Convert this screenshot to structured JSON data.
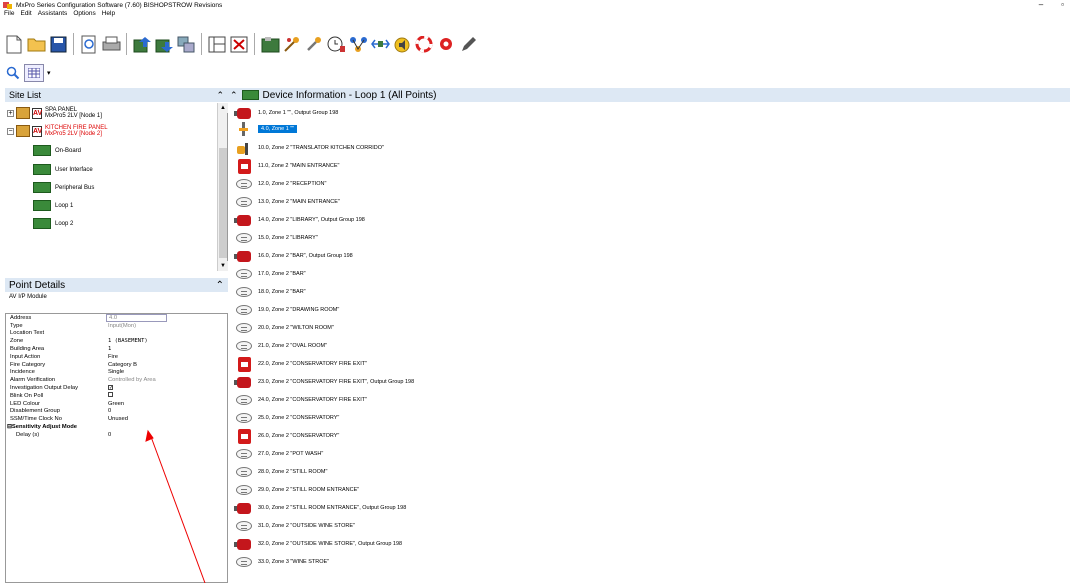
{
  "window": {
    "title": "MxPro Series Configuration Software (7.60)   BISHOPSTROW Revisions",
    "minimize": "–",
    "maximize": "▫"
  },
  "menu": [
    "File",
    "Edit",
    "Assistants",
    "Options",
    "Help"
  ],
  "toolbar_icons": [
    "new-file-icon",
    "open-folder-icon",
    "save-icon",
    "print-preview-icon",
    "print-icon",
    "upload-icon",
    "download-icon",
    "compare-icon",
    "layout-icon",
    "delete-icon",
    "panel-icon",
    "wizard-icon",
    "tools-icon",
    "clock-icon",
    "network-icon",
    "io-icon",
    "sound-icon",
    "help-ring-icon",
    "settings-icon",
    "pen-icon"
  ],
  "site_list": {
    "title": "Site List",
    "nodes": [
      {
        "line1": "SPA PANEL",
        "line2": "MxPro5 2LV [Node 1]",
        "av": "AV",
        "expander": "+",
        "highlight": false
      },
      {
        "line1": "KITCHEN FIRE PANEL",
        "line2": "MxPro5 2LV [Node 2]",
        "av": "AV",
        "expander": "−",
        "highlight": true
      }
    ],
    "children": [
      "On-Board",
      "User Interface",
      "Peripheral Bus",
      "Loop 1",
      "Loop 2"
    ]
  },
  "point_details": {
    "title": "Point Details",
    "subtitle": "AV I/P Module",
    "rows": [
      {
        "label": "Address",
        "value": "4.0",
        "style": "box"
      },
      {
        "label": "Type",
        "value": "Input(Mon)",
        "style": "grey"
      },
      {
        "label": "Location Text",
        "value": "",
        "style": ""
      },
      {
        "label": "Zone",
        "value": "1 (BASEMENT)",
        "style": "mono"
      },
      {
        "label": "Building Area",
        "value": "1",
        "style": "mono"
      },
      {
        "label": "Input Action",
        "value": "Fire",
        "style": ""
      },
      {
        "label": "Fire Category",
        "value": "Category B",
        "style": ""
      },
      {
        "label": "Incidence",
        "value": "Single",
        "style": ""
      },
      {
        "label": "Alarm Verification",
        "value": "Controlled by Area",
        "style": "grey"
      },
      {
        "label": "Investigation Output Delay",
        "value": "✓",
        "style": "check"
      },
      {
        "label": "Blink On Poll",
        "value": "",
        "style": "check"
      },
      {
        "label": "LED Colour",
        "value": "Green",
        "style": ""
      },
      {
        "label": "Disablement Group",
        "value": "0",
        "style": ""
      },
      {
        "label": "SSM/Time Clock No",
        "value": "Unused",
        "style": ""
      }
    ],
    "section": "Sensitivity Adjust Mode",
    "section_rows": [
      {
        "label": "Delay (s)",
        "value": "0"
      }
    ]
  },
  "device_info": {
    "title": "Device Information - Loop 1  (All Points)",
    "devices": [
      {
        "icon": "sounder",
        "text": "1.0, Zone 1 \"\",  Output Group 198",
        "selected": false
      },
      {
        "icon": "io",
        "text": "4.0, Zone 1 \"\"",
        "selected": true
      },
      {
        "icon": "translator",
        "text": "10.0, Zone 2 \"TRANSLATOR KITCHEN CORRIDO\"",
        "selected": false
      },
      {
        "icon": "callpoint",
        "text": "11.0, Zone 2 \"MAIN ENTRANCE\"",
        "selected": false
      },
      {
        "icon": "detector",
        "text": "12.0, Zone 2 \"RECEPTION\"",
        "selected": false
      },
      {
        "icon": "detector",
        "text": "13.0, Zone 2 \"MAIN ENTRANCE\"",
        "selected": false
      },
      {
        "icon": "sounder",
        "text": "14.0, Zone 2 \"LIBRARY\",  Output Group 198",
        "selected": false
      },
      {
        "icon": "detector",
        "text": "15.0, Zone 2 \"LIBRARY\"",
        "selected": false
      },
      {
        "icon": "sounder",
        "text": "16.0, Zone 2 \"BAR\",  Output Group 198",
        "selected": false
      },
      {
        "icon": "detector",
        "text": "17.0, Zone 2 \"BAR\"",
        "selected": false
      },
      {
        "icon": "detector",
        "text": "18.0, Zone 2 \"BAR\"",
        "selected": false
      },
      {
        "icon": "detector",
        "text": "19.0, Zone 2 \"DRAWING ROOM\"",
        "selected": false
      },
      {
        "icon": "detector",
        "text": "20.0, Zone 2 \"WILTON ROOM\"",
        "selected": false
      },
      {
        "icon": "detector",
        "text": "21.0, Zone 2 \"OVAL ROOM\"",
        "selected": false
      },
      {
        "icon": "callpoint",
        "text": "22.0, Zone 2 \"CONSERVATORY FIRE EXIT\"",
        "selected": false
      },
      {
        "icon": "sounder",
        "text": "23.0, Zone 2 \"CONSERVATORY FIRE EXIT\",  Output Group 198",
        "selected": false
      },
      {
        "icon": "detector",
        "text": "24.0, Zone 2 \"CONSERVATORY FIRE EXIT\"",
        "selected": false
      },
      {
        "icon": "detector",
        "text": "25.0, Zone 2 \"CONSERVATORY\"",
        "selected": false
      },
      {
        "icon": "callpoint",
        "text": "26.0, Zone 2 \"CONSERVATORY\"",
        "selected": false
      },
      {
        "icon": "detector",
        "text": "27.0, Zone 2 \"POT WASH\"",
        "selected": false
      },
      {
        "icon": "detector",
        "text": "28.0, Zone 2 \"STILL ROOM\"",
        "selected": false
      },
      {
        "icon": "detector",
        "text": "29.0, Zone 2 \"STILL ROOM ENTRANCE\"",
        "selected": false
      },
      {
        "icon": "sounder",
        "text": "30.0, Zone 2 \"STILL ROOM ENTRANCE\",  Output Group 198",
        "selected": false
      },
      {
        "icon": "detector",
        "text": "31.0, Zone 2 \"OUTSIDE WINE STORE\"",
        "selected": false
      },
      {
        "icon": "sounder",
        "text": "32.0, Zone 2 \"OUTSIDE WINE STORE\",  Output Group 198",
        "selected": false
      },
      {
        "icon": "detector",
        "text": "33.0, Zone 3 \"WINE STROE\"",
        "selected": false
      }
    ]
  },
  "colors": {
    "header_bg": "#dde8f4",
    "selection": "#0078d7",
    "alert_red": "#d00000"
  }
}
